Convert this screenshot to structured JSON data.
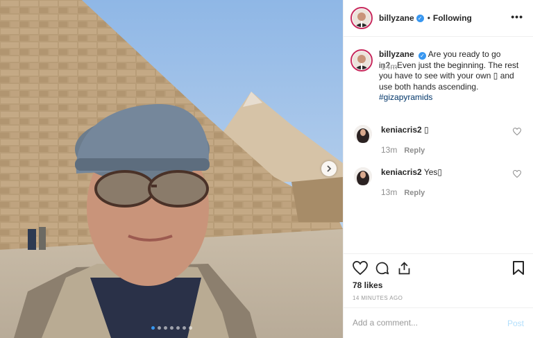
{
  "post": {
    "username": "billyzane",
    "follow_separator": "•",
    "follow_status": "Following",
    "more_icon": "more-options-icon",
    "caption_text": "Are you ready to go in?...Even just the beginning. The rest you have to see with your own ▯ and use both hands ascending.",
    "hashtag": "#gizapyramids",
    "caption_time": "14m"
  },
  "comments": [
    {
      "username": "keniacris2",
      "text": "▯",
      "time": "13m",
      "reply_label": "Reply"
    },
    {
      "username": "keniacris2",
      "text": "Yes▯",
      "time": "13m",
      "reply_label": "Reply"
    }
  ],
  "actions": {
    "likes": "78 likes",
    "posted_ago": "14 MINUTES AGO",
    "comment_placeholder": "Add a comment...",
    "post_label": "Post"
  },
  "carousel": {
    "slide_count": 7,
    "active_index": 0
  },
  "colors": {
    "accent": "#3897f0",
    "post_disabled": "#b2dffc",
    "avatar_ring": "#c7295c"
  }
}
